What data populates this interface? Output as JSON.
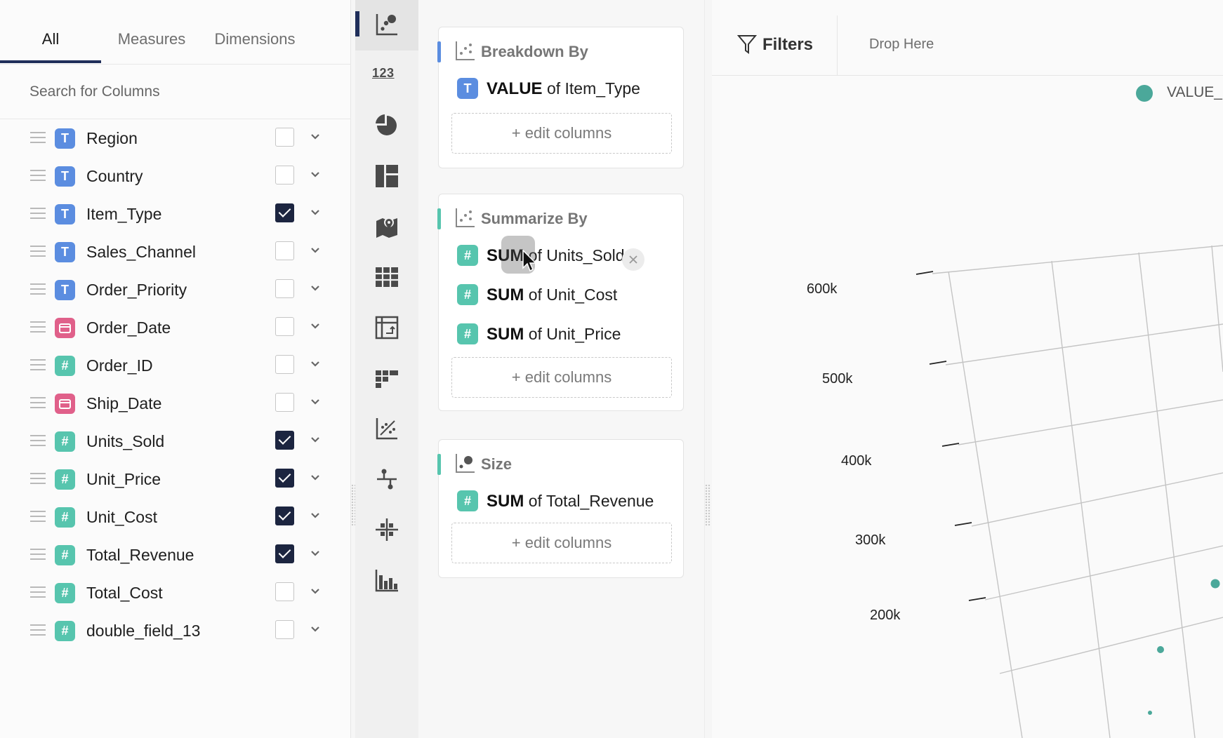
{
  "tabs": {
    "all": "All",
    "measures": "Measures",
    "dimensions": "Dimensions"
  },
  "search": {
    "placeholder": "Search for Columns"
  },
  "columns": [
    {
      "name": "Region",
      "type": "T",
      "checked": false
    },
    {
      "name": "Country",
      "type": "T",
      "checked": false
    },
    {
      "name": "Item_Type",
      "type": "T",
      "checked": true
    },
    {
      "name": "Sales_Channel",
      "type": "T",
      "checked": false
    },
    {
      "name": "Order_Priority",
      "type": "T",
      "checked": false
    },
    {
      "name": "Order_Date",
      "type": "D",
      "checked": false
    },
    {
      "name": "Order_ID",
      "type": "N",
      "checked": false
    },
    {
      "name": "Ship_Date",
      "type": "D",
      "checked": false
    },
    {
      "name": "Units_Sold",
      "type": "N",
      "checked": true
    },
    {
      "name": "Unit_Price",
      "type": "N",
      "checked": true
    },
    {
      "name": "Unit_Cost",
      "type": "N",
      "checked": true
    },
    {
      "name": "Total_Revenue",
      "type": "N",
      "checked": true
    },
    {
      "name": "Total_Cost",
      "type": "N",
      "checked": false
    },
    {
      "name": "double_field_13",
      "type": "N",
      "checked": false
    }
  ],
  "type_badges": {
    "T": "T",
    "N": "#",
    "D": ""
  },
  "viz_toolbar": {
    "number_label": "123",
    "icons": [
      "scatter-plot-icon",
      "number-icon",
      "pie-chart-icon",
      "treemap-icon",
      "map-icon",
      "table-icon",
      "pivot-icon",
      "heatmap-icon",
      "correlation-icon",
      "line-sparkline-icon",
      "crosshair-icon",
      "histogram-icon"
    ],
    "active": "scatter-plot-icon"
  },
  "breakdown": {
    "title": "Breakdown By",
    "items": [
      {
        "agg": "VALUE",
        "of": "of Item_Type",
        "type": "T"
      }
    ],
    "edit_label": "+ edit columns"
  },
  "summarize": {
    "title": "Summarize By",
    "items": [
      {
        "agg": "SUM",
        "of": "of Units_Sold",
        "type": "N"
      },
      {
        "agg": "SUM",
        "of": "of Unit_Cost",
        "type": "N"
      },
      {
        "agg": "SUM",
        "of": "of Unit_Price",
        "type": "N"
      }
    ],
    "edit_label": "+ edit columns"
  },
  "size": {
    "title": "Size",
    "items": [
      {
        "agg": "SUM",
        "of": "of Total_Revenue",
        "type": "N"
      }
    ],
    "edit_label": "+ edit columns"
  },
  "filters": {
    "label": "Filters",
    "drop_label": "Drop Here"
  },
  "legend": {
    "label": "VALUE_"
  },
  "colors": {
    "accent": "#1f2e5a",
    "text_type": "#5b8de0",
    "number_type": "#57c5ae",
    "date_type": "#e0608a",
    "series": "#4ba89a",
    "summarize_accent": "#57c5ae",
    "breakdown_accent": "#5b8de0"
  },
  "chart_data": {
    "type": "scatter",
    "title": "",
    "axis_ticks": [
      "600k",
      "500k",
      "400k",
      "300k",
      "200k"
    ]
  }
}
